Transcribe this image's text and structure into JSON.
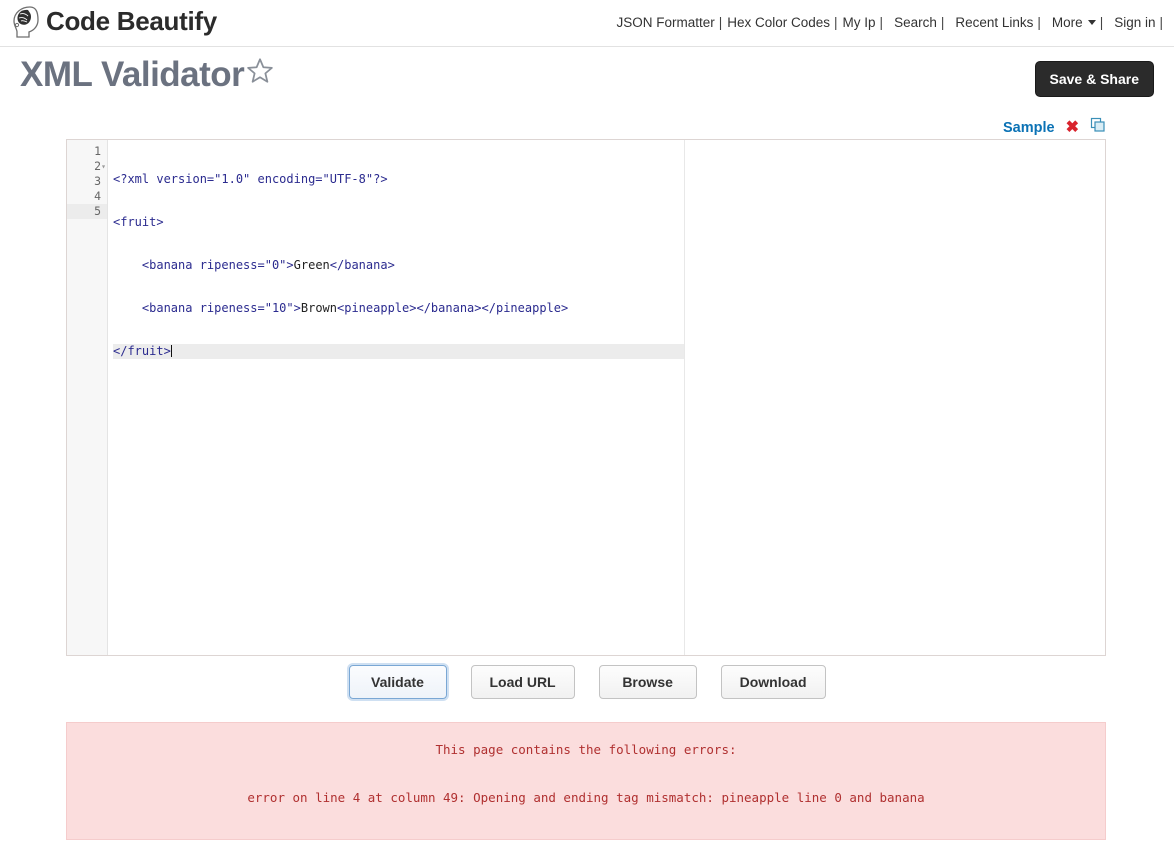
{
  "header": {
    "logo_icon": "brain-head-logo-icon",
    "brand": "Code Beautify",
    "nav": [
      {
        "label": "JSON Formatter",
        "sep": "|"
      },
      {
        "label": "Hex Color Codes",
        "sep": "|"
      },
      {
        "label": "My Ip",
        "sep": "|"
      },
      {
        "label": "Search",
        "sep": "|"
      },
      {
        "label": "Recent Links",
        "sep": "|"
      },
      {
        "label": "More",
        "sep": "|",
        "caret": true
      },
      {
        "label": "Sign in",
        "sep": "|"
      }
    ]
  },
  "title": {
    "text": "XML Validator",
    "star_icon": "star-outline-icon"
  },
  "actions": {
    "save_share": "Save & Share"
  },
  "toolrow": {
    "sample": "Sample",
    "clear_icon": "close-x-icon",
    "copy_icon": "copy-icon"
  },
  "editor": {
    "lines": [
      {
        "n": "1",
        "fold": "",
        "active": false
      },
      {
        "n": "2",
        "fold": "▾",
        "active": false
      },
      {
        "n": "3",
        "fold": "",
        "active": false
      },
      {
        "n": "4",
        "fold": "",
        "active": false
      },
      {
        "n": "5",
        "fold": "",
        "active": true
      }
    ],
    "code_text": [
      "<?xml version=\"1.0\" encoding=\"UTF-8\"?>",
      "<fruit>",
      "    <banana ripeness=\"0\">Green</banana>",
      "    <banana ripeness=\"10\">Brown<pineapple></banana></pineapple>",
      "</fruit>"
    ]
  },
  "buttons": {
    "validate": "Validate",
    "load_url": "Load URL",
    "browse": "Browse",
    "download": "Download"
  },
  "errors": {
    "title": "This page contains the following errors:",
    "message": "error on line 4 at column 49: Opening and ending tag mismatch: pineapple line 0 and banana"
  },
  "colors": {
    "accent_link": "#0b72b5",
    "error_bg": "#fbdddd",
    "error_text": "#b03030",
    "dark_button": "#2b2b2b"
  }
}
